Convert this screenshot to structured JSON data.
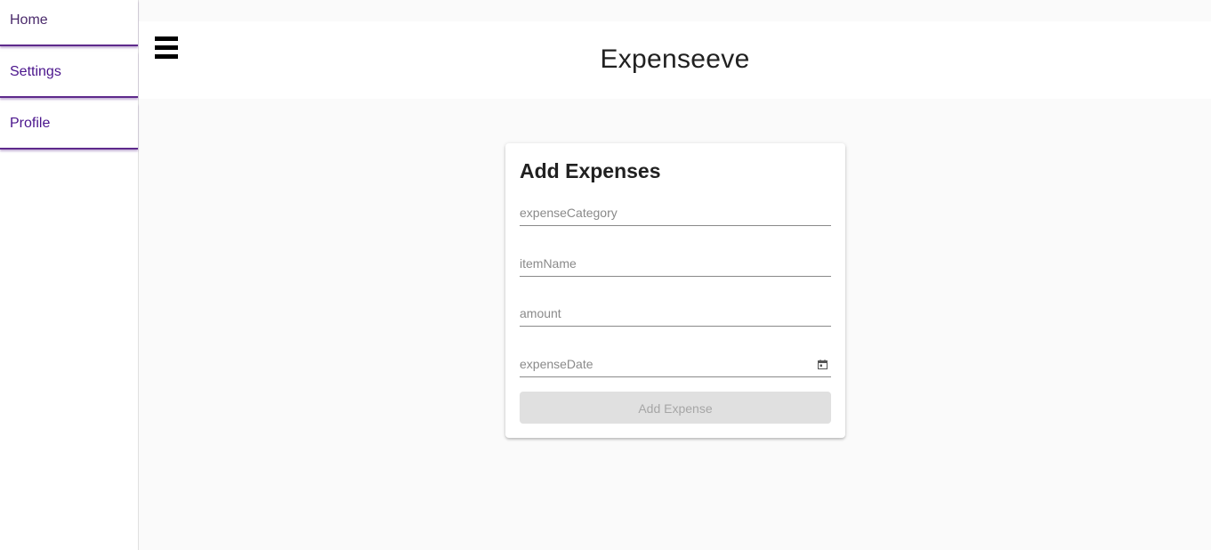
{
  "sidebar": {
    "items": [
      {
        "label": "Home"
      },
      {
        "label": "Settings"
      },
      {
        "label": "Profile"
      }
    ]
  },
  "header": {
    "title": "Expenseeve",
    "menu_icon": "hamburger-menu-icon"
  },
  "form": {
    "title": "Add Expenses",
    "fields": [
      {
        "name": "expenseCategory",
        "placeholder": "expenseCategory",
        "value": ""
      },
      {
        "name": "itemName",
        "placeholder": "itemName",
        "value": ""
      },
      {
        "name": "amount",
        "placeholder": "amount",
        "value": ""
      },
      {
        "name": "expenseDate",
        "placeholder": "expenseDate",
        "value": "",
        "icon": "calendar-icon"
      }
    ],
    "submit_label": "Add Expense",
    "submit_disabled": true
  },
  "colors": {
    "nav_text": "#4a148c",
    "nav_underline": "#5e2a8c",
    "background": "#fafafa",
    "button_disabled_bg": "#e0e0e0",
    "button_disabled_text": "#a6a6a6"
  }
}
